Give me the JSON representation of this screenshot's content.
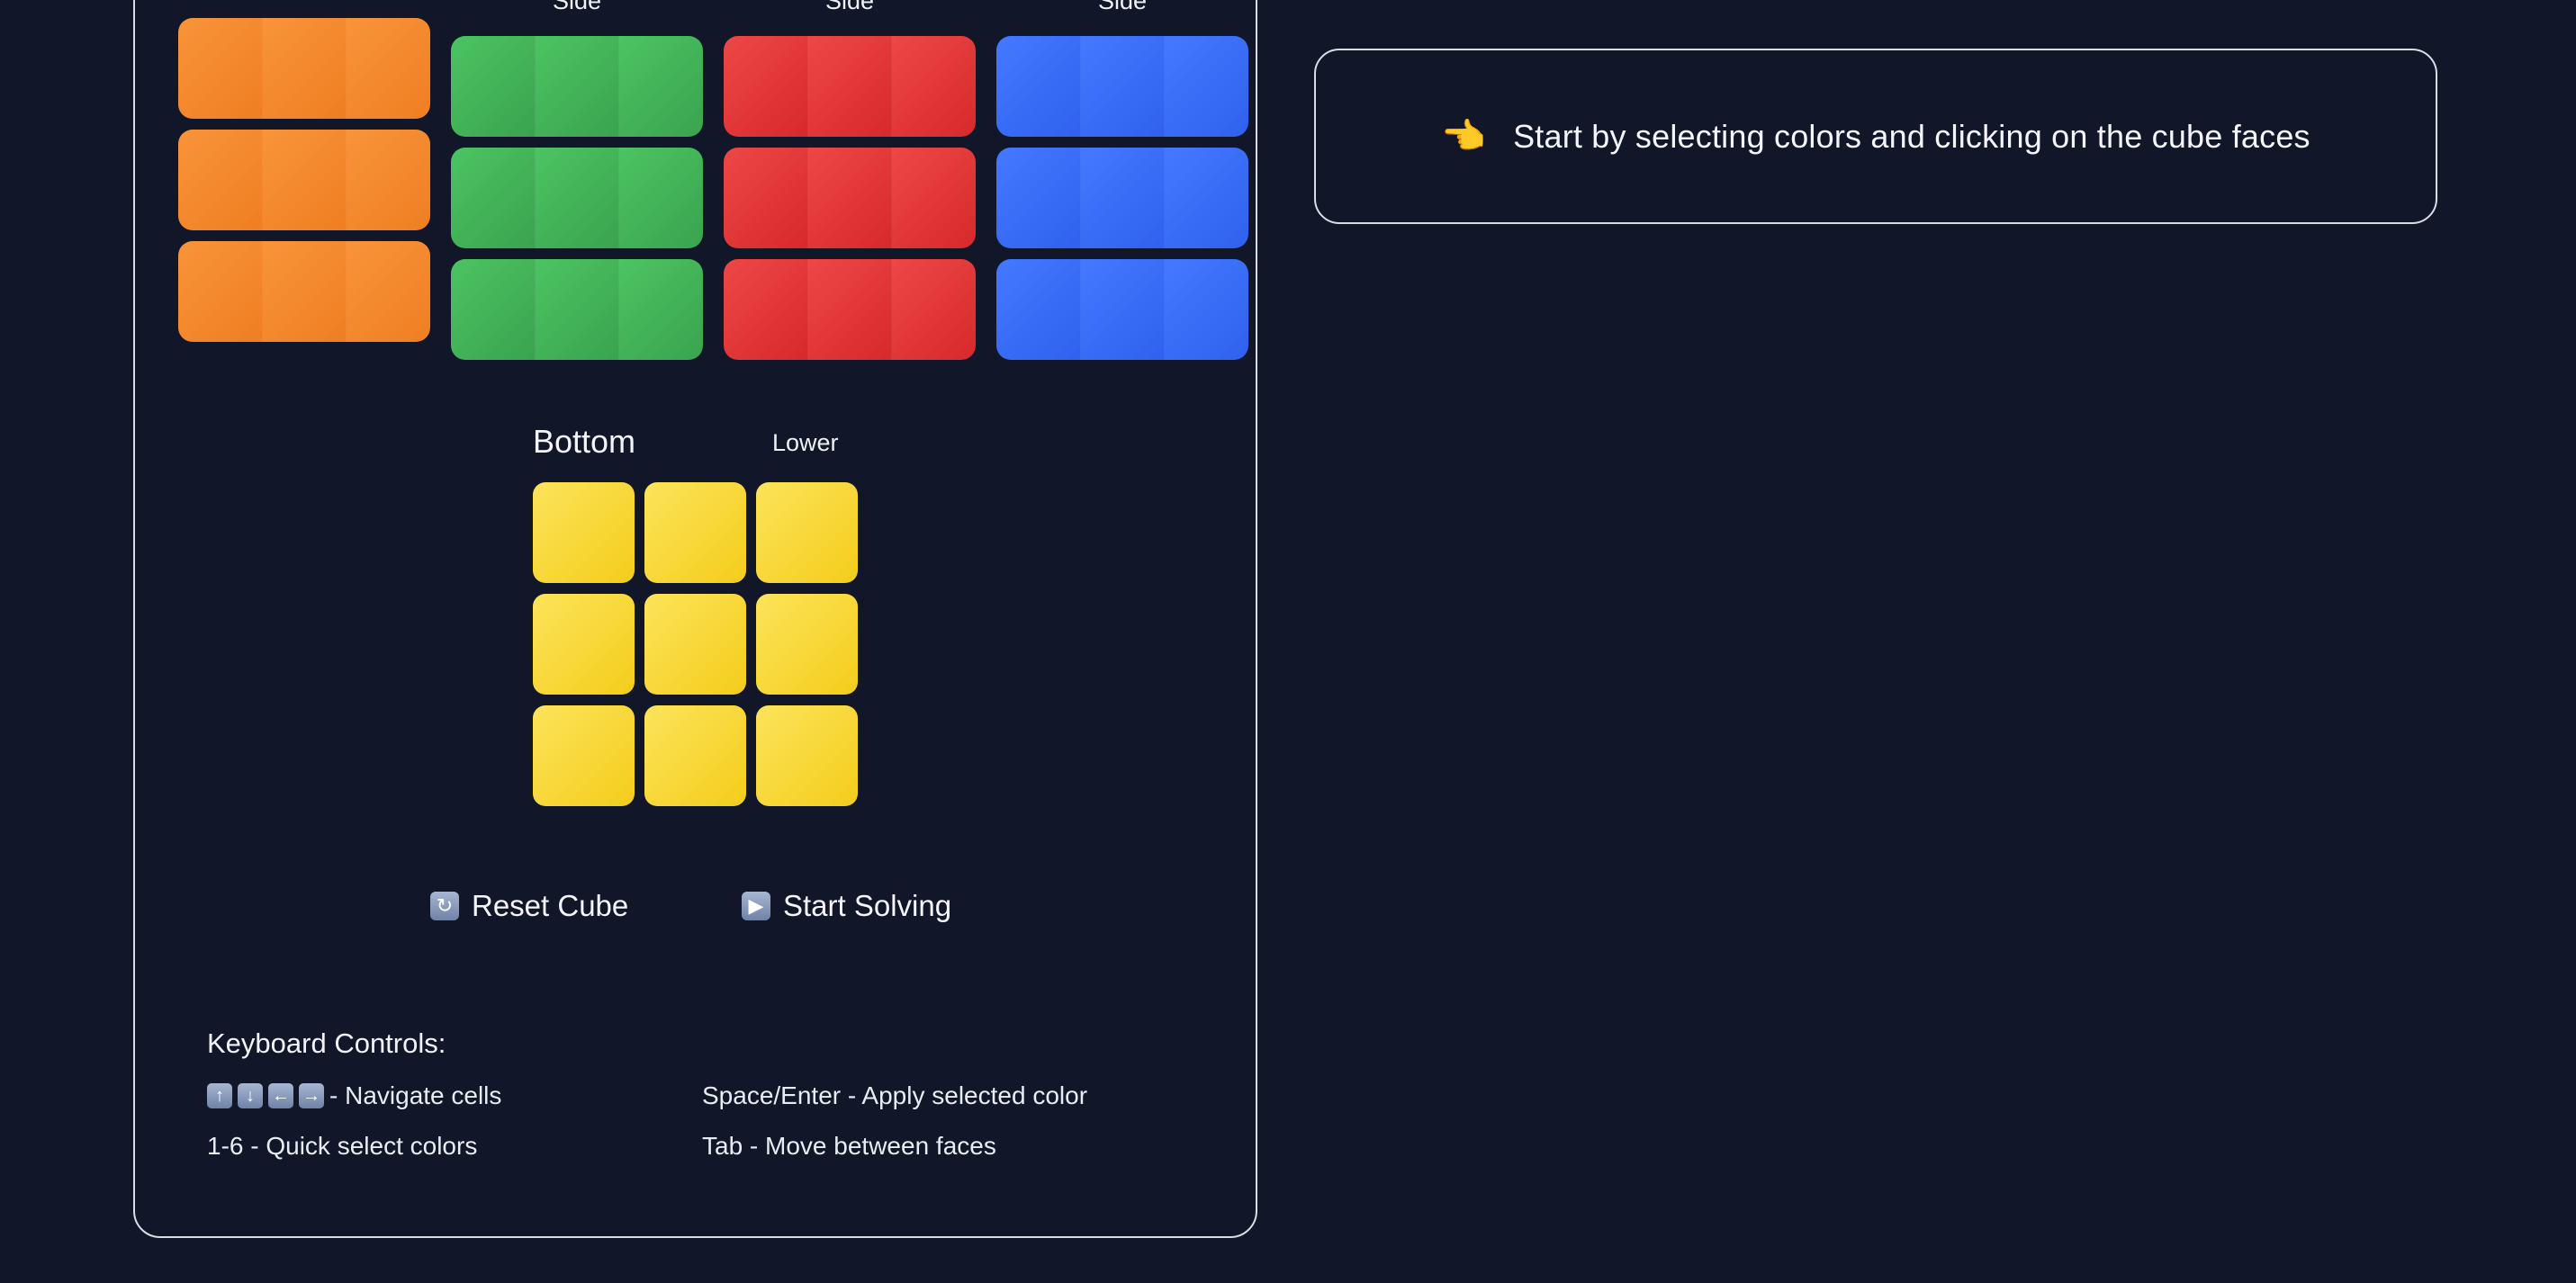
{
  "faces_top": {
    "green_label": "Side",
    "red_label": "Side",
    "blue_label": "Side"
  },
  "bottom_face": {
    "title": "Bottom",
    "subtitle": "Lower",
    "color": "#f7d531"
  },
  "face_colors": {
    "orange": "#f38a2e",
    "green": "#43b559",
    "red": "#e03a3b",
    "blue": "#3a6dfa",
    "yellow": "#f7d531"
  },
  "actions": {
    "reset_label": "Reset Cube",
    "reset_icon": "refresh-icon",
    "solve_label": "Start Solving",
    "solve_icon": "play-icon"
  },
  "keyboard": {
    "title": "Keyboard Controls:",
    "navigate": "- Navigate cells",
    "apply": "Space/Enter - Apply selected color",
    "quick_select": "1-6 - Quick select colors",
    "move_faces": "Tab - Move between faces",
    "arrow_icons": [
      "arrow-up-icon",
      "arrow-down-icon",
      "arrow-left-icon",
      "arrow-right-icon"
    ]
  },
  "hint": {
    "icon": "pointing-hand-icon",
    "text": "Start by selecting colors and clicking on the cube faces"
  }
}
